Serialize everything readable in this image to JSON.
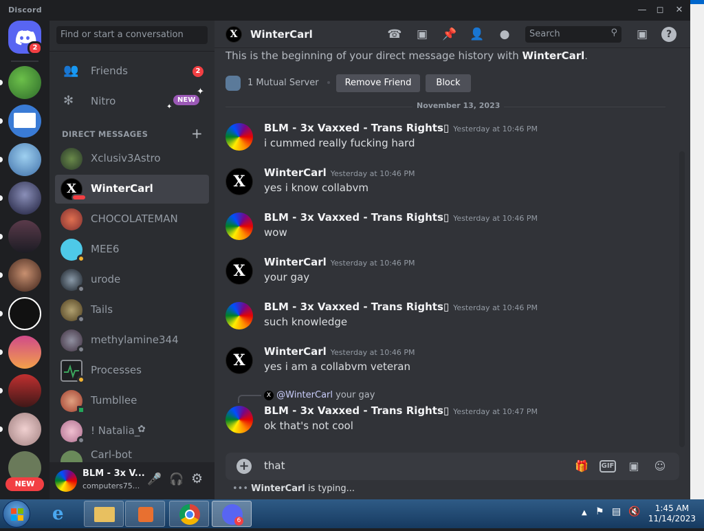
{
  "window": {
    "title": "Discord"
  },
  "servers": {
    "home_badge": "2",
    "new_label": "NEW"
  },
  "dm": {
    "search_placeholder": "Find or start a conversation",
    "friends_label": "Friends",
    "friends_badge": "2",
    "nitro_label": "Nitro",
    "nitro_badge": "NEW",
    "section_header": "DIRECT MESSAGES",
    "items": [
      {
        "name": "Xclusiv3Astro"
      },
      {
        "name": "WinterCarl"
      },
      {
        "name": "CHOCOLATEMAN"
      },
      {
        "name": "MEE6"
      },
      {
        "name": "urode"
      },
      {
        "name": "Tails"
      },
      {
        "name": "methylamine344"
      },
      {
        "name": "Processes"
      },
      {
        "name": "Tumbllee"
      },
      {
        "name": "! Natalia_"
      },
      {
        "name": "Carl-bot"
      }
    ],
    "user": {
      "name": "BLM - 3x V...",
      "status": "computers75..."
    }
  },
  "channel": {
    "name": "WinterCarl",
    "search_placeholder": "Search",
    "beginning_text": "This is the beginning of your direct message history with ",
    "beginning_name": "WinterCarl",
    "beginning_end": ".",
    "mutual": "1 Mutual Server",
    "remove_friend": "Remove Friend",
    "block": "Block",
    "date": "November 13, 2023"
  },
  "messages": [
    {
      "author": "BLM - 3x Vaxxed - Trans Rights▯",
      "time": "Yesterday at 10:46 PM",
      "text": "i cummed really fucking hard"
    },
    {
      "author": "WinterCarl",
      "time": "Yesterday at 10:46 PM",
      "text": "yes i know collabvm"
    },
    {
      "author": "BLM - 3x Vaxxed - Trans Rights▯",
      "time": "Yesterday at 10:46 PM",
      "text": "wow"
    },
    {
      "author": "WinterCarl",
      "time": "Yesterday at 10:46 PM",
      "text": "your gay"
    },
    {
      "author": "BLM - 3x Vaxxed - Trans Rights▯",
      "time": "Yesterday at 10:46 PM",
      "text": "such knowledge"
    },
    {
      "author": "WinterCarl",
      "time": "Yesterday at 10:46 PM",
      "text": "yes i am a collabvm veteran"
    },
    {
      "author": "BLM - 3x Vaxxed - Trans Rights▯",
      "time": "Yesterday at 10:47 PM",
      "text": "ok that's not cool"
    }
  ],
  "reply": {
    "mention": "@WinterCarl",
    "text": "your gay"
  },
  "composer": {
    "text": "that",
    "gif": "GIF"
  },
  "typing": {
    "user": "WinterCarl",
    "text": " is typing..."
  },
  "taskbar": {
    "time": "1:45 AM",
    "date": "11/14/2023",
    "discord_badge": "6"
  },
  "colors": {
    "accent": "#5865f2",
    "red": "#f23f43",
    "nitro": "#9b59b6"
  }
}
